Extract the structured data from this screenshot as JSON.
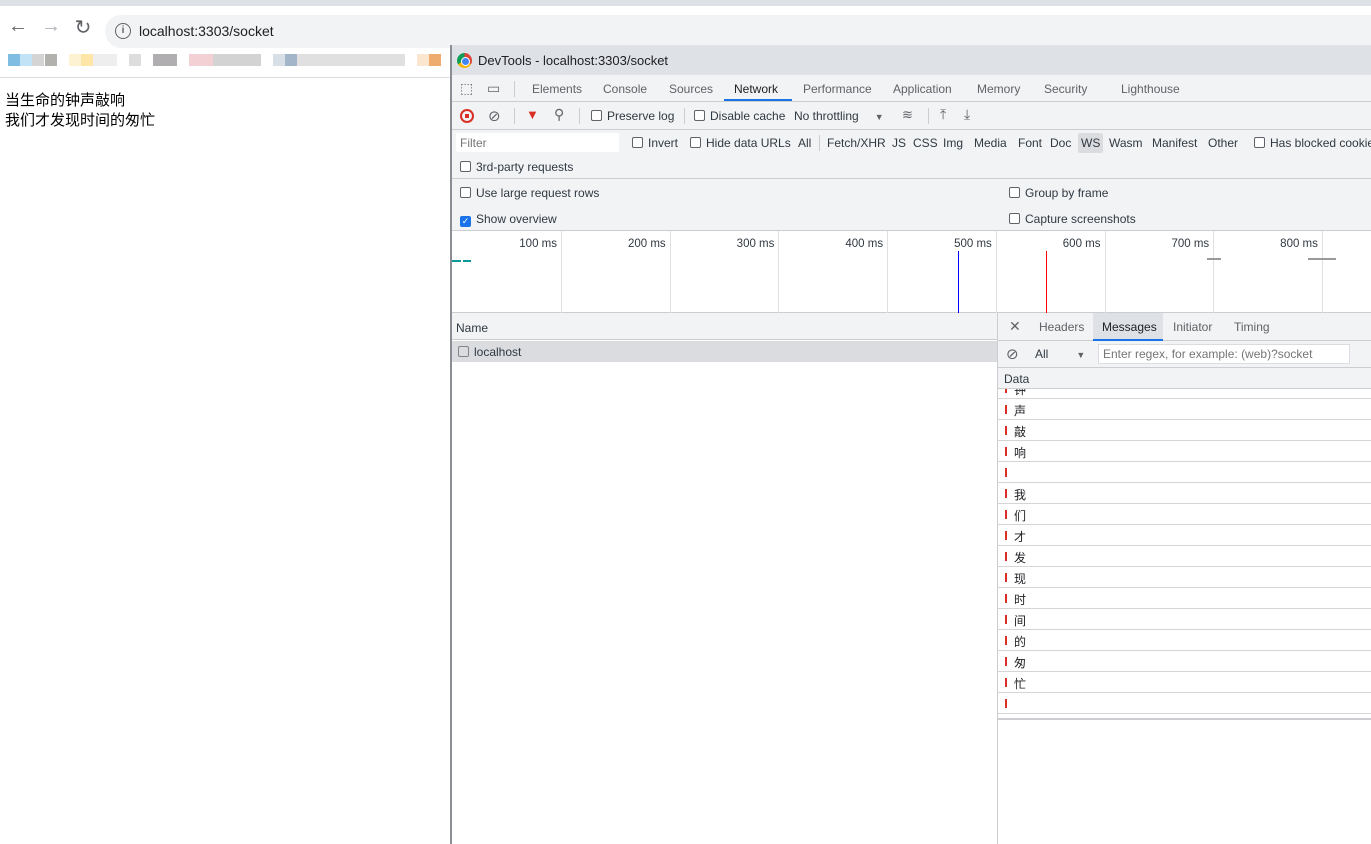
{
  "browser": {
    "url": "localhost:3303/socket"
  },
  "page": {
    "lines": [
      "当生命的钟声敲响",
      "我们才发现时间的匆忙"
    ]
  },
  "devtools": {
    "title": "DevTools - localhost:3303/socket",
    "tabs": [
      "Elements",
      "Console",
      "Sources",
      "Network",
      "Performance",
      "Application",
      "Memory",
      "Security",
      "Lighthouse"
    ],
    "active_tab": "Network",
    "toolbar": {
      "preserve_log": "Preserve log",
      "disable_cache": "Disable cache",
      "throttling": "No throttling"
    },
    "filter": {
      "placeholder": "Filter",
      "invert": "Invert",
      "hide_data_urls": "Hide data URLs",
      "types": [
        "All",
        "Fetch/XHR",
        "JS",
        "CSS",
        "Img",
        "Media",
        "Font",
        "Doc",
        "WS",
        "Wasm",
        "Manifest",
        "Other"
      ],
      "active_type": "WS",
      "has_blocked": "Has blocked cookies",
      "third_party": "3rd-party requests"
    },
    "settings": {
      "large_rows": "Use large request rows",
      "show_overview": "Show overview",
      "show_overview_checked": true,
      "group_by_frame": "Group by frame",
      "capture_screenshots": "Capture screenshots"
    },
    "overview": {
      "ticks": [
        "100 ms",
        "200 ms",
        "300 ms",
        "400 ms",
        "500 ms",
        "600 ms",
        "700 ms",
        "800 ms"
      ],
      "dom_content_loaded_color": "#0000ff",
      "load_color": "#ff0000"
    },
    "requests": {
      "header": "Name",
      "items": [
        {
          "name": "localhost"
        }
      ]
    },
    "detail": {
      "tabs": [
        "Headers",
        "Messages",
        "Initiator",
        "Timing"
      ],
      "active_tab": "Messages",
      "filter_select": "All",
      "regex_placeholder": "Enter regex, for example: (web)?socket",
      "data_header": "Data",
      "messages": [
        "钟",
        "声",
        "敲",
        "响",
        "",
        "我",
        "们",
        "才",
        "发",
        "现",
        "时",
        "间",
        "的",
        "匆",
        "忙",
        ""
      ],
      "received_color": "#d93025"
    }
  }
}
